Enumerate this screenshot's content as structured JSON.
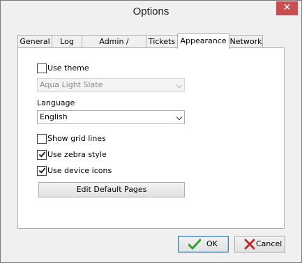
{
  "window": {
    "title": "Options",
    "close_glyph": "✕"
  },
  "tabs": [
    {
      "label": "General"
    },
    {
      "label": "Log"
    },
    {
      "label": "Admin / Cashiers"
    },
    {
      "label": "Tickets"
    },
    {
      "label": "Appearance",
      "active": true
    },
    {
      "label": "Network"
    }
  ],
  "appearance": {
    "use_theme": {
      "label": "Use theme",
      "checked": false
    },
    "theme_select": {
      "value": "Aqua Light Slate",
      "disabled": true
    },
    "language_label": "Language",
    "language_select": {
      "value": "English"
    },
    "show_grid_lines": {
      "label": "Show grid lines",
      "checked": false
    },
    "use_zebra_style": {
      "label": "Use zebra style",
      "checked": true
    },
    "use_device_icons": {
      "label": "Use device icons",
      "checked": true
    },
    "edit_default_pages_label": "Edit Default Pages"
  },
  "footer": {
    "ok_label": "OK",
    "ok_icon": "green-check-icon",
    "cancel_label": "Cancel",
    "cancel_icon": "red-x-icon"
  },
  "colors": {
    "close_button": "#c74f4f",
    "ok_check": "#2e9e2e",
    "cancel_x": "#c22a2a"
  }
}
